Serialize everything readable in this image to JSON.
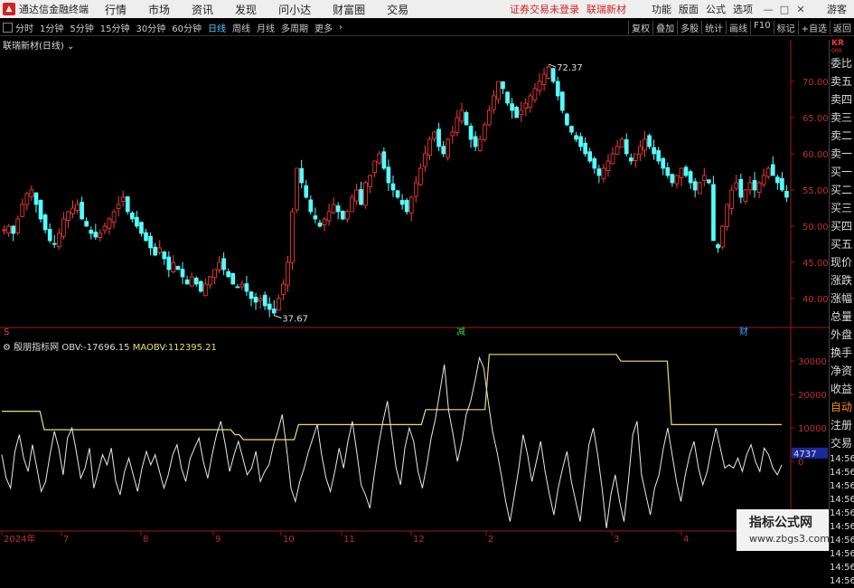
{
  "app": {
    "name": "通达信金融终端",
    "menus": [
      "行情",
      "市场",
      "资讯",
      "发现",
      "问小达",
      "财富圈",
      "交易"
    ],
    "notice": "证券交易未登录",
    "stock_title": "联瑞新材",
    "right_menus": [
      "功能",
      "版面",
      "公式",
      "选项"
    ],
    "guest": "游客",
    "win_controls": [
      "—",
      "□",
      "✕"
    ]
  },
  "toolbar": {
    "periods": [
      "分时",
      "1分钟",
      "5分钟",
      "15分钟",
      "30分钟",
      "60分钟",
      "日线",
      "周线",
      "月线",
      "多周期",
      "更多"
    ],
    "active": "日线",
    "right": [
      "复权",
      "叠加",
      "多股",
      "统计",
      "画线",
      "F10",
      "标记",
      "+自选",
      "返回"
    ]
  },
  "main_chart": {
    "title": "联瑞新材(日线)",
    "high_label": "72.37",
    "low_label": "37.67",
    "y_ticks": [
      "70.00",
      "65.00",
      "60.00",
      "55.00",
      "50.00",
      "45.00",
      "40.00"
    ],
    "markers": [
      "S",
      "减",
      "财"
    ]
  },
  "indicator": {
    "name": "殷朋指标网",
    "obv_label": "OBV:",
    "obv_value": "-17696.15",
    "maobv_label": "MAOBV:",
    "maobv_value": "112395.21",
    "y_ticks": [
      "30000",
      "20000",
      "10000",
      "0"
    ],
    "current": "4737"
  },
  "x_axis": [
    "2024年",
    "7",
    "8",
    "9",
    "10",
    "11",
    "12",
    "2",
    "3",
    "4"
  ],
  "right_panel": {
    "code": "KR",
    "sub": "000",
    "items": [
      "委比",
      "卖五",
      "卖四",
      "卖三",
      "卖二",
      "卖一",
      "买一",
      "买二",
      "买三",
      "买四",
      "买五",
      "现价",
      "涨跌",
      "涨幅",
      "总量",
      "外盘",
      "换手",
      "净资",
      "收益",
      "自动",
      "注册",
      "交易"
    ],
    "highlight": "自动",
    "times": [
      "14:56",
      "14:56",
      "14:56",
      "14:56",
      "14:56",
      "14:56",
      "14:56",
      "14:56",
      "14:56",
      "14:56"
    ]
  },
  "watermark": {
    "name": "指标公式网",
    "url": "www.zbgs3.com"
  },
  "chart_data": {
    "type": "candlestick",
    "price_range": [
      37,
      74
    ],
    "highest": 72.37,
    "lowest": 37.67,
    "close_series": [
      49.5,
      50,
      49,
      51,
      53,
      54.5,
      55,
      53,
      51,
      49.5,
      48,
      47.5,
      49,
      51,
      52,
      52.5,
      53,
      51,
      50,
      49,
      48.5,
      49,
      50,
      51,
      52,
      53,
      54,
      52,
      51,
      50,
      49,
      48,
      47,
      46,
      47,
      45.5,
      44,
      45,
      44,
      43,
      42,
      43,
      42,
      41,
      42,
      43,
      44,
      45,
      44,
      43,
      42,
      41.5,
      42,
      41,
      40,
      39.5,
      40,
      39,
      38.5,
      38,
      40,
      42,
      45,
      52,
      58,
      56,
      54,
      52,
      51,
      50,
      51,
      52,
      53,
      52,
      51,
      52,
      54,
      55,
      53,
      56,
      57,
      59,
      60,
      58,
      56,
      55,
      54,
      53,
      52,
      54,
      56,
      58,
      60,
      62,
      63,
      61,
      60,
      62,
      63,
      65,
      66,
      64,
      62,
      61,
      62,
      64,
      66,
      68,
      70,
      69,
      67,
      66,
      65,
      66,
      67,
      68,
      69,
      70,
      71,
      72,
      70,
      68,
      66,
      64,
      63,
      62,
      61,
      60,
      59,
      58,
      57,
      58,
      59,
      60,
      61,
      62,
      60,
      59,
      60,
      61,
      62,
      61,
      60,
      59,
      58,
      57,
      56,
      57,
      58,
      57,
      56,
      55,
      56,
      57,
      56,
      48,
      47,
      50,
      53,
      55,
      56,
      54,
      55,
      56,
      55,
      56,
      57,
      58,
      57,
      56,
      55,
      54
    ],
    "obv_range": [
      -20000,
      36000
    ],
    "maobv": [
      15000,
      15000,
      15000,
      15000,
      15000,
      15000,
      15000,
      15000,
      15000,
      15000,
      9500,
      9500,
      9500,
      9500,
      9500,
      9500,
      9500,
      9500,
      9500,
      9500,
      9500,
      9500,
      9500,
      9500,
      9500,
      9500,
      9500,
      9500,
      9500,
      9500,
      9500,
      9500,
      9500,
      9500,
      9500,
      9500,
      9500,
      9500,
      9500,
      9500,
      9500,
      9500,
      9500,
      9500,
      9500,
      9500,
      9500,
      9500,
      9500,
      9500,
      9500,
      9500,
      9500,
      9500,
      9500,
      8000,
      8000,
      6500,
      6500,
      6500,
      6500,
      6500,
      6500,
      6500,
      6500,
      6500,
      6500,
      6500,
      6500,
      6500,
      11000,
      11000,
      11000,
      11000,
      11000,
      11000,
      11000,
      11000,
      11000,
      11000,
      11000,
      11000,
      11000,
      11000,
      11000,
      11000,
      11000,
      11000,
      11000,
      11000,
      11000,
      11000,
      11000,
      11000,
      11000,
      11000,
      11000,
      11000,
      11000,
      11000,
      15500,
      15500,
      15500,
      15500,
      15500,
      15500,
      15500,
      15500,
      15500,
      15500,
      15500,
      15500,
      15500,
      15500,
      15500,
      32000,
      32000,
      32000,
      32000,
      32000,
      32000,
      32000,
      32000,
      32000,
      32000,
      32000,
      32000,
      32000,
      32000,
      32000,
      32000,
      32000,
      32000,
      32000,
      32000,
      32000,
      32000,
      32000,
      32000,
      32000,
      32000,
      32000,
      32000,
      32000,
      32000,
      32000,
      30000,
      30000,
      30000,
      30000,
      30000,
      30000,
      30000,
      30000,
      30000,
      30000,
      30000,
      30000,
      11000,
      11000,
      11000,
      11000,
      11000,
      11000,
      11000,
      11000,
      11000,
      11000,
      11000,
      11000,
      11000,
      11000,
      11000,
      11000,
      11000,
      11000,
      11000,
      11000,
      11000,
      11000,
      11000,
      11000,
      11000,
      11000,
      11000
    ],
    "obv": [
      2000,
      -5000,
      -8000,
      3000,
      8000,
      1000,
      -3000,
      5000,
      -2000,
      -9000,
      -6000,
      2000,
      9000,
      4000,
      -4000,
      7000,
      10000,
      3000,
      -5000,
      -2000,
      4000,
      -8000,
      -3000,
      2000,
      -1000,
      4000,
      -6000,
      -10000,
      -3000,
      1000,
      -4000,
      -9000,
      -2000,
      3000,
      -1000,
      2000,
      -3000,
      -8000,
      -4000,
      2000,
      5000,
      -2000,
      -6000,
      1000,
      4000,
      7000,
      0,
      -5000,
      2000,
      8000,
      12000,
      5000,
      -3000,
      2000,
      6000,
      1000,
      -4000,
      -2000,
      3000,
      -6000,
      -3000,
      -1000,
      5000,
      9000,
      14000,
      4000,
      -8000,
      -12000,
      -6000,
      -2000,
      3000,
      7000,
      11000,
      2000,
      -5000,
      -9000,
      -3000,
      4000,
      -2000,
      6000,
      12000,
      3000,
      -7000,
      -10000,
      -14000,
      -4000,
      5000,
      12000,
      18000,
      8000,
      -2000,
      -7000,
      4000,
      10000,
      6000,
      -3000,
      -8000,
      -1000,
      7000,
      13000,
      21000,
      29000,
      15000,
      8000,
      0,
      6000,
      14000,
      18000,
      24000,
      31000,
      28000,
      18000,
      9000,
      3000,
      -4000,
      -12000,
      -18000,
      -10000,
      -2000,
      8000,
      2000,
      -6000,
      0,
      6000,
      -3000,
      -10000,
      -16000,
      -8000,
      -2000,
      3000,
      -6000,
      -12000,
      -18000,
      -6000,
      5000,
      10000,
      2000,
      -8000,
      -20000,
      -10000,
      -4000,
      -12000,
      -18000,
      -6000,
      8000,
      12000,
      -4000,
      -10000,
      -16000,
      -8000,
      -4000,
      4000,
      10000,
      2000,
      -6000,
      -12000,
      -4000,
      2000,
      6000,
      -2000,
      -7000,
      -3000,
      4000,
      10000,
      4000,
      -2000,
      -1000,
      -2000,
      1000,
      -3000,
      2000,
      5000,
      0,
      -3000,
      4000,
      2000,
      -2000,
      -4000,
      -1000
    ]
  }
}
